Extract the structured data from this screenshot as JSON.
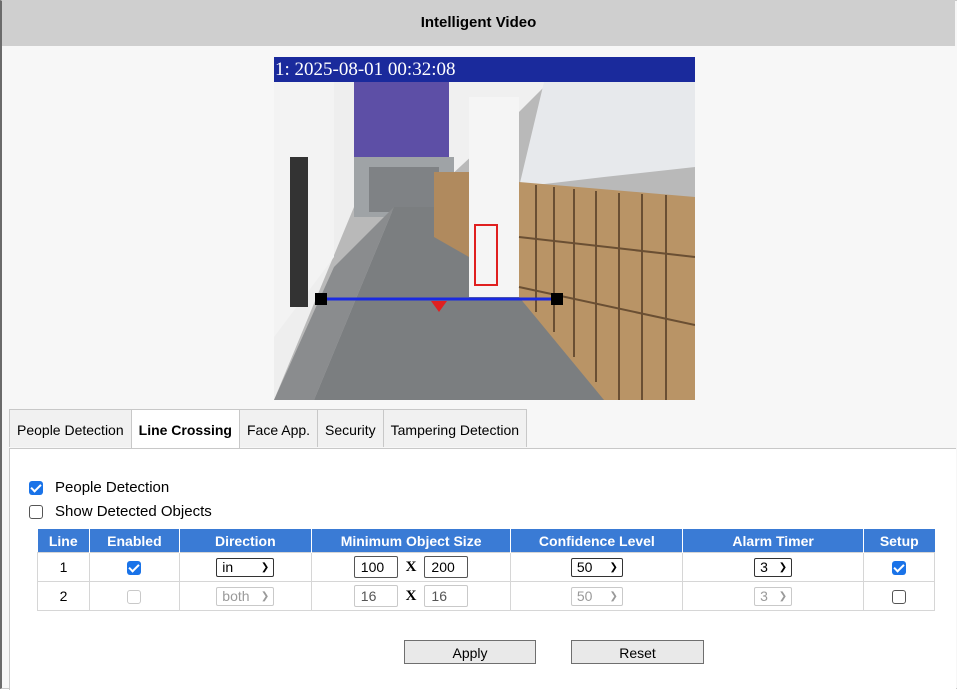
{
  "header": {
    "title": "Intelligent Video"
  },
  "video": {
    "osd_text": "1: 2025-08-01 00:32:08"
  },
  "tabs": [
    {
      "label": "People Detection",
      "active": false
    },
    {
      "label": "Line Crossing",
      "active": true
    },
    {
      "label": "Face App.",
      "active": false
    },
    {
      "label": "Security",
      "active": false
    },
    {
      "label": "Tampering Detection",
      "active": false
    }
  ],
  "options": {
    "people_detection": {
      "label": "People Detection",
      "checked": true
    },
    "show_detected_objects": {
      "label": "Show Detected Objects",
      "checked": false
    }
  },
  "table": {
    "headers": [
      "Line",
      "Enabled",
      "Direction",
      "Minimum Object Size",
      "Confidence Level",
      "Alarm Timer",
      "Setup"
    ],
    "size_separator": "X",
    "rows": [
      {
        "line": "1",
        "enabled": true,
        "direction": "in",
        "min_w": "100",
        "min_h": "200",
        "confidence": "50",
        "alarm_timer": "3",
        "setup": true,
        "disabled": false
      },
      {
        "line": "2",
        "enabled": false,
        "direction": "both",
        "min_w": "16",
        "min_h": "16",
        "confidence": "50",
        "alarm_timer": "3",
        "setup": false,
        "disabled": true
      }
    ]
  },
  "buttons": {
    "apply": "Apply",
    "reset": "Reset"
  },
  "colors": {
    "header_blue": "#3a7bd5",
    "osd_blue": "#1a2a9c",
    "checkbox_blue": "#1a73e8",
    "line_blue": "#1a2ae0",
    "marker_red": "#e02020"
  }
}
